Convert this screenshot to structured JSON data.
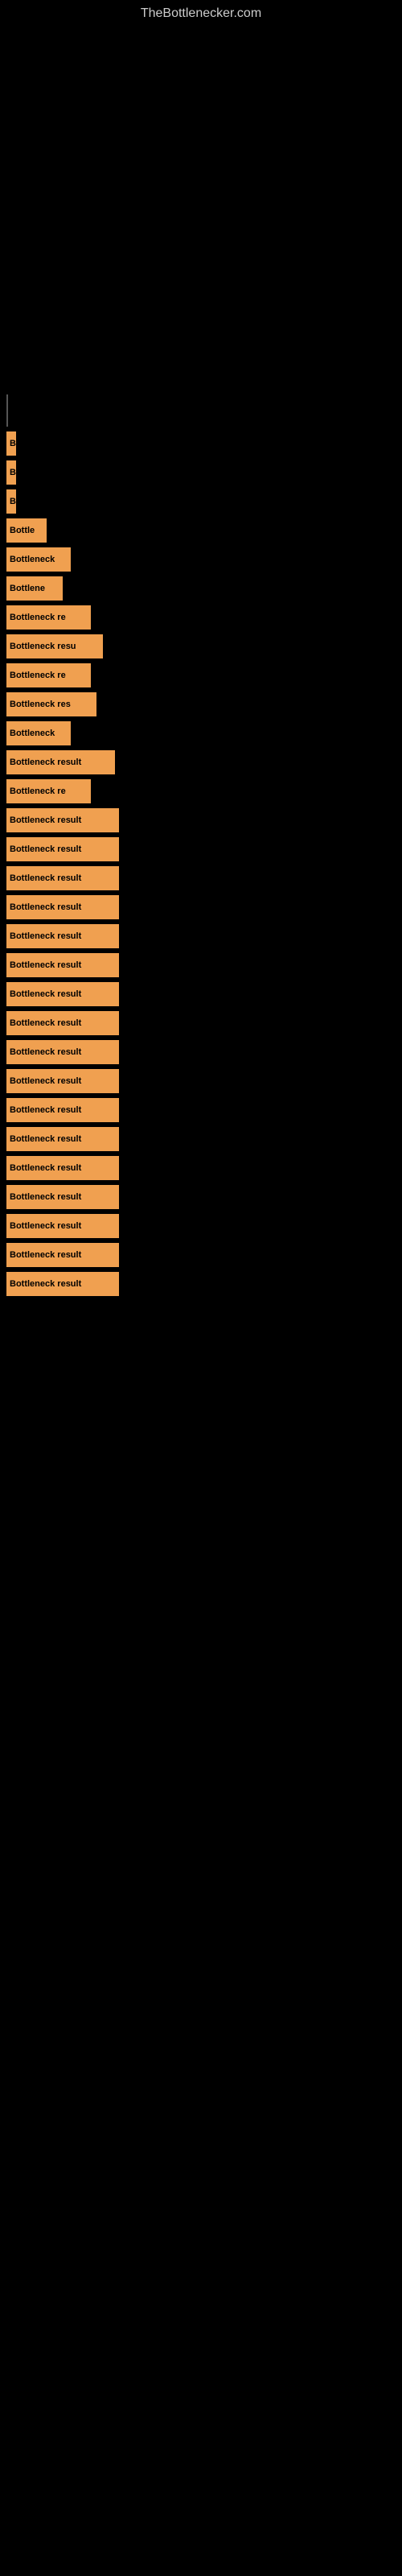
{
  "site": {
    "title": "TheBottlenecker.com"
  },
  "bars": [
    {
      "id": 1,
      "label": "B",
      "width": 12
    },
    {
      "id": 2,
      "label": "B",
      "width": 12
    },
    {
      "id": 3,
      "label": "B",
      "width": 12
    },
    {
      "id": 4,
      "label": "Bottle",
      "width": 50
    },
    {
      "id": 5,
      "label": "Bottleneck",
      "width": 80
    },
    {
      "id": 6,
      "label": "Bottlene",
      "width": 70
    },
    {
      "id": 7,
      "label": "Bottleneck re",
      "width": 105
    },
    {
      "id": 8,
      "label": "Bottleneck resu",
      "width": 120
    },
    {
      "id": 9,
      "label": "Bottleneck re",
      "width": 105
    },
    {
      "id": 10,
      "label": "Bottleneck res",
      "width": 112
    },
    {
      "id": 11,
      "label": "Bottleneck",
      "width": 80
    },
    {
      "id": 12,
      "label": "Bottleneck result",
      "width": 135
    },
    {
      "id": 13,
      "label": "Bottleneck re",
      "width": 105
    },
    {
      "id": 14,
      "label": "Bottleneck result",
      "width": 140
    },
    {
      "id": 15,
      "label": "Bottleneck result",
      "width": 140
    },
    {
      "id": 16,
      "label": "Bottleneck result",
      "width": 140
    },
    {
      "id": 17,
      "label": "Bottleneck result",
      "width": 140
    },
    {
      "id": 18,
      "label": "Bottleneck result",
      "width": 140
    },
    {
      "id": 19,
      "label": "Bottleneck result",
      "width": 140
    },
    {
      "id": 20,
      "label": "Bottleneck result",
      "width": 140
    },
    {
      "id": 21,
      "label": "Bottleneck result",
      "width": 140
    },
    {
      "id": 22,
      "label": "Bottleneck result",
      "width": 140
    },
    {
      "id": 23,
      "label": "Bottleneck result",
      "width": 140
    },
    {
      "id": 24,
      "label": "Bottleneck result",
      "width": 140
    },
    {
      "id": 25,
      "label": "Bottleneck result",
      "width": 140
    },
    {
      "id": 26,
      "label": "Bottleneck result",
      "width": 140
    },
    {
      "id": 27,
      "label": "Bottleneck result",
      "width": 140
    },
    {
      "id": 28,
      "label": "Bottleneck result",
      "width": 140
    },
    {
      "id": 29,
      "label": "Bottleneck result",
      "width": 140
    },
    {
      "id": 30,
      "label": "Bottleneck result",
      "width": 140
    }
  ]
}
